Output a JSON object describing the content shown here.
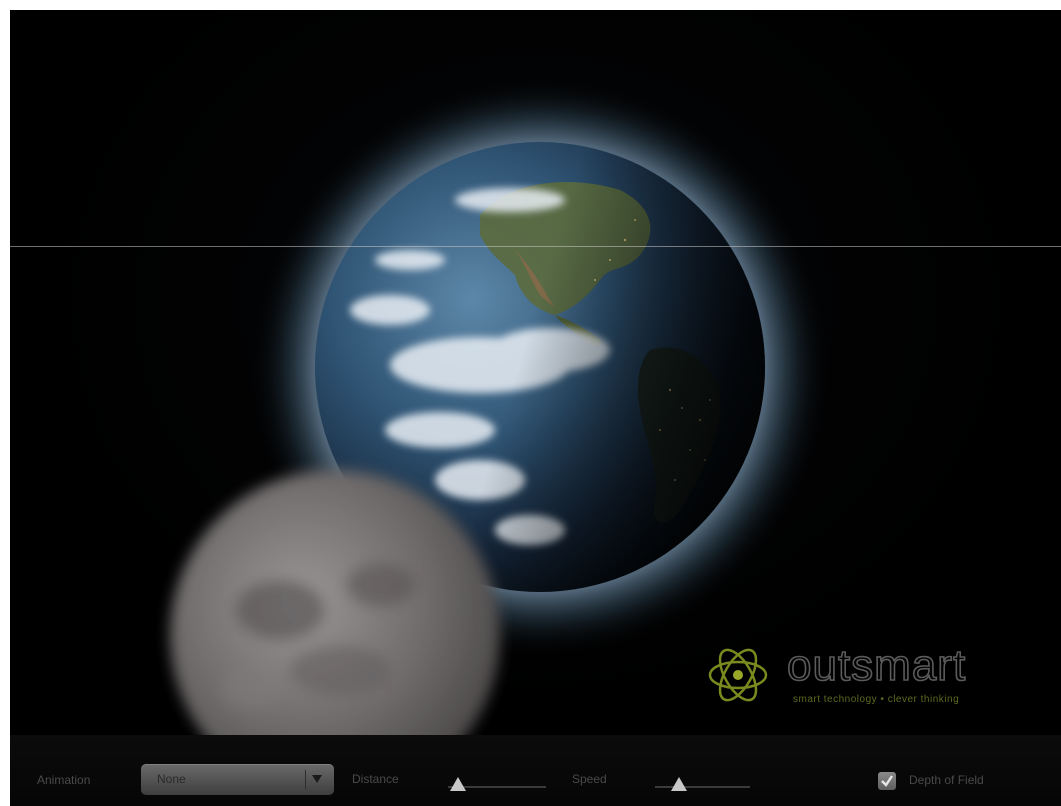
{
  "toolbar": {
    "animation_label": "Animation",
    "animation_value": "None",
    "distance_label": "Distance",
    "distance_level": 0.1,
    "speed_label": "Speed",
    "speed_level": 0.25,
    "depth_of_field_label": "Depth of Field",
    "depth_of_field_checked": true
  },
  "logo": {
    "wordmark": "outsmart",
    "tagline": "smart technology • clever thinking"
  },
  "icons": [
    "chevron-down-icon",
    "checkmark-icon",
    "atom-logo-icon"
  ],
  "colors": {
    "background": "#000000",
    "toolbar": "#0a0a0a",
    "logo_accent": "#7a8a1e"
  }
}
